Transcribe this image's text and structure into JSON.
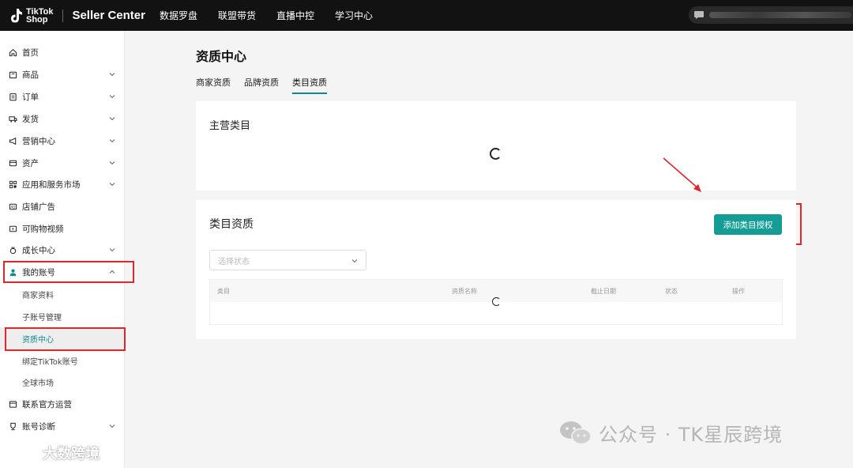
{
  "topbar": {
    "logo_line1": "TikTok",
    "logo_line2": "Shop",
    "brand": "Seller Center",
    "nav": [
      "数据罗盘",
      "联盟带货",
      "直播中控",
      "学习中心"
    ]
  },
  "sidebar": {
    "items": [
      {
        "label": "首页",
        "icon": "home-icon"
      },
      {
        "label": "商品",
        "icon": "box-icon"
      },
      {
        "label": "订单",
        "icon": "clipboard-icon"
      },
      {
        "label": "发货",
        "icon": "truck-icon"
      },
      {
        "label": "营销中心",
        "icon": "megaphone-icon"
      },
      {
        "label": "资产",
        "icon": "wallet-icon"
      },
      {
        "label": "应用和服务市场",
        "icon": "apps-icon"
      },
      {
        "label": "店铺广告",
        "icon": "ad-icon"
      },
      {
        "label": "可购物视频",
        "icon": "video-icon"
      },
      {
        "label": "成长中心",
        "icon": "growth-icon"
      },
      {
        "label": "我的账号",
        "icon": "user-icon"
      },
      {
        "label": "商家资料"
      },
      {
        "label": "子账号管理"
      },
      {
        "label": "资质中心"
      },
      {
        "label": "绑定TikTok账号"
      },
      {
        "label": "全球市场"
      },
      {
        "label": "联系官方运营",
        "icon": "contact-icon"
      },
      {
        "label": "账号诊断",
        "icon": "trophy-icon"
      }
    ]
  },
  "main": {
    "title": "资质中心",
    "tabs": [
      "商家资质",
      "品牌资质",
      "类目资质"
    ],
    "active_tab": "类目资质",
    "main_category": {
      "title": "主营类目"
    },
    "category_qual": {
      "title": "类目资质",
      "add_button": "添加类目授权",
      "select_placeholder": "选择状态",
      "columns": [
        "类目",
        "资质名称",
        "截止日期",
        "状态",
        "操作"
      ]
    }
  },
  "watermarks": {
    "right": "公众号 · TK星辰跨境",
    "left": "大数跨境"
  },
  "colors": {
    "accent": "#149c95",
    "highlight_box": "#e0262b",
    "topbar": "#121212"
  }
}
